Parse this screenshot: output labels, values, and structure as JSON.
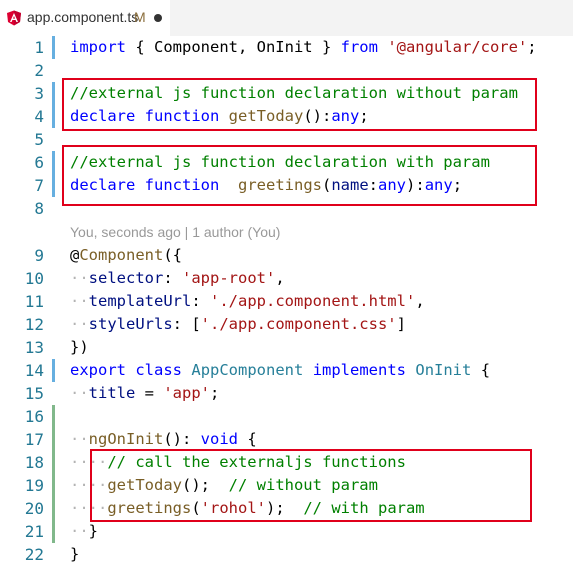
{
  "tab": {
    "title": "app.component.ts",
    "badge": "M",
    "icon": "angular-icon"
  },
  "codelens": "You, seconds ago | 1 author (You)",
  "lines": [
    {
      "n": "1",
      "tokens": [
        [
          "kw",
          "import"
        ],
        [
          "p",
          " { Component, OnInit } "
        ],
        [
          "kw",
          "from"
        ],
        [
          "p",
          " "
        ],
        [
          "str",
          "'@angular/core'"
        ],
        [
          "p",
          ";"
        ]
      ]
    },
    {
      "n": "2",
      "tokens": []
    },
    {
      "n": "3",
      "tokens": [
        [
          "cmt",
          "//external js function declaration without param"
        ]
      ]
    },
    {
      "n": "4",
      "tokens": [
        [
          "kw",
          "declare"
        ],
        [
          "p",
          " "
        ],
        [
          "kw",
          "function"
        ],
        [
          "p",
          " "
        ],
        [
          "fn",
          "getToday"
        ],
        [
          "p",
          "():"
        ],
        [
          "kw",
          "any"
        ],
        [
          "p",
          ";"
        ]
      ]
    },
    {
      "n": "5",
      "tokens": []
    },
    {
      "n": "6",
      "tokens": [
        [
          "cmt",
          "//external js function declaration with param"
        ]
      ]
    },
    {
      "n": "7",
      "tokens": [
        [
          "kw",
          "declare"
        ],
        [
          "p",
          " "
        ],
        [
          "kw",
          "function"
        ],
        [
          "p",
          "  "
        ],
        [
          "fn",
          "greetings"
        ],
        [
          "p",
          "("
        ],
        [
          "var",
          "name"
        ],
        [
          "p",
          ":"
        ],
        [
          "kw",
          "any"
        ],
        [
          "p",
          "):"
        ],
        [
          "kw",
          "any"
        ],
        [
          "p",
          ";"
        ]
      ]
    },
    {
      "n": "8",
      "tokens": []
    },
    {
      "n": "9",
      "tokens": [
        [
          "p",
          "@"
        ],
        [
          "fn",
          "Component"
        ],
        [
          "p",
          "({"
        ]
      ]
    },
    {
      "n": "10",
      "tokens": [
        [
          "dots",
          "··"
        ],
        [
          "var",
          "selector"
        ],
        [
          "p",
          ": "
        ],
        [
          "str",
          "'app-root'"
        ],
        [
          "p",
          ","
        ]
      ]
    },
    {
      "n": "11",
      "tokens": [
        [
          "dots",
          "··"
        ],
        [
          "var",
          "templateUrl"
        ],
        [
          "p",
          ": "
        ],
        [
          "str",
          "'./app.component.html'"
        ],
        [
          "p",
          ","
        ]
      ]
    },
    {
      "n": "12",
      "tokens": [
        [
          "dots",
          "··"
        ],
        [
          "var",
          "styleUrls"
        ],
        [
          "p",
          ": ["
        ],
        [
          "str",
          "'./app.component.css'"
        ],
        [
          "p",
          "]"
        ]
      ]
    },
    {
      "n": "13",
      "tokens": [
        [
          "p",
          "})"
        ]
      ]
    },
    {
      "n": "14",
      "tokens": [
        [
          "kw",
          "export"
        ],
        [
          "p",
          " "
        ],
        [
          "kw",
          "class"
        ],
        [
          "p",
          " "
        ],
        [
          "ty",
          "AppComponent"
        ],
        [
          "p",
          " "
        ],
        [
          "kw",
          "implements"
        ],
        [
          "p",
          " "
        ],
        [
          "ty",
          "OnInit"
        ],
        [
          "p",
          " {"
        ]
      ]
    },
    {
      "n": "15",
      "tokens": [
        [
          "dots",
          "··"
        ],
        [
          "var",
          "title"
        ],
        [
          "p",
          " = "
        ],
        [
          "str",
          "'app'"
        ],
        [
          "p",
          ";"
        ]
      ]
    },
    {
      "n": "16",
      "tokens": []
    },
    {
      "n": "17",
      "tokens": [
        [
          "dots",
          "··"
        ],
        [
          "fn",
          "ngOnInit"
        ],
        [
          "p",
          "(): "
        ],
        [
          "kw",
          "void"
        ],
        [
          "p",
          " {"
        ]
      ]
    },
    {
      "n": "18",
      "tokens": [
        [
          "dots",
          "····"
        ],
        [
          "cmt",
          "// call the externaljs functions"
        ]
      ]
    },
    {
      "n": "19",
      "tokens": [
        [
          "dots",
          "····"
        ],
        [
          "fn",
          "getToday"
        ],
        [
          "p",
          "();  "
        ],
        [
          "cmt",
          "// without param"
        ]
      ]
    },
    {
      "n": "20",
      "tokens": [
        [
          "dots",
          "····"
        ],
        [
          "fn",
          "greetings"
        ],
        [
          "p",
          "("
        ],
        [
          "str",
          "'rohol'"
        ],
        [
          "p",
          ");  "
        ],
        [
          "cmt",
          "// with param"
        ]
      ]
    },
    {
      "n": "21",
      "tokens": [
        [
          "dots",
          "··"
        ],
        [
          "p",
          "}"
        ]
      ]
    },
    {
      "n": "22",
      "tokens": [
        [
          "p",
          "}"
        ]
      ]
    }
  ],
  "gutter": {
    "1": "mod",
    "3": "mod",
    "4": "mod",
    "6": "mod",
    "7": "mod",
    "14": "mod",
    "16": "add",
    "17": "add",
    "18": "add",
    "19": "add",
    "20": "add",
    "21": "add"
  },
  "colors": {
    "highlight_border": "#e0001b",
    "keyword": "#0000ff",
    "string": "#a31515",
    "comment": "#008000",
    "type": "#267f99",
    "function": "#795e26",
    "line_number": "#237893"
  }
}
